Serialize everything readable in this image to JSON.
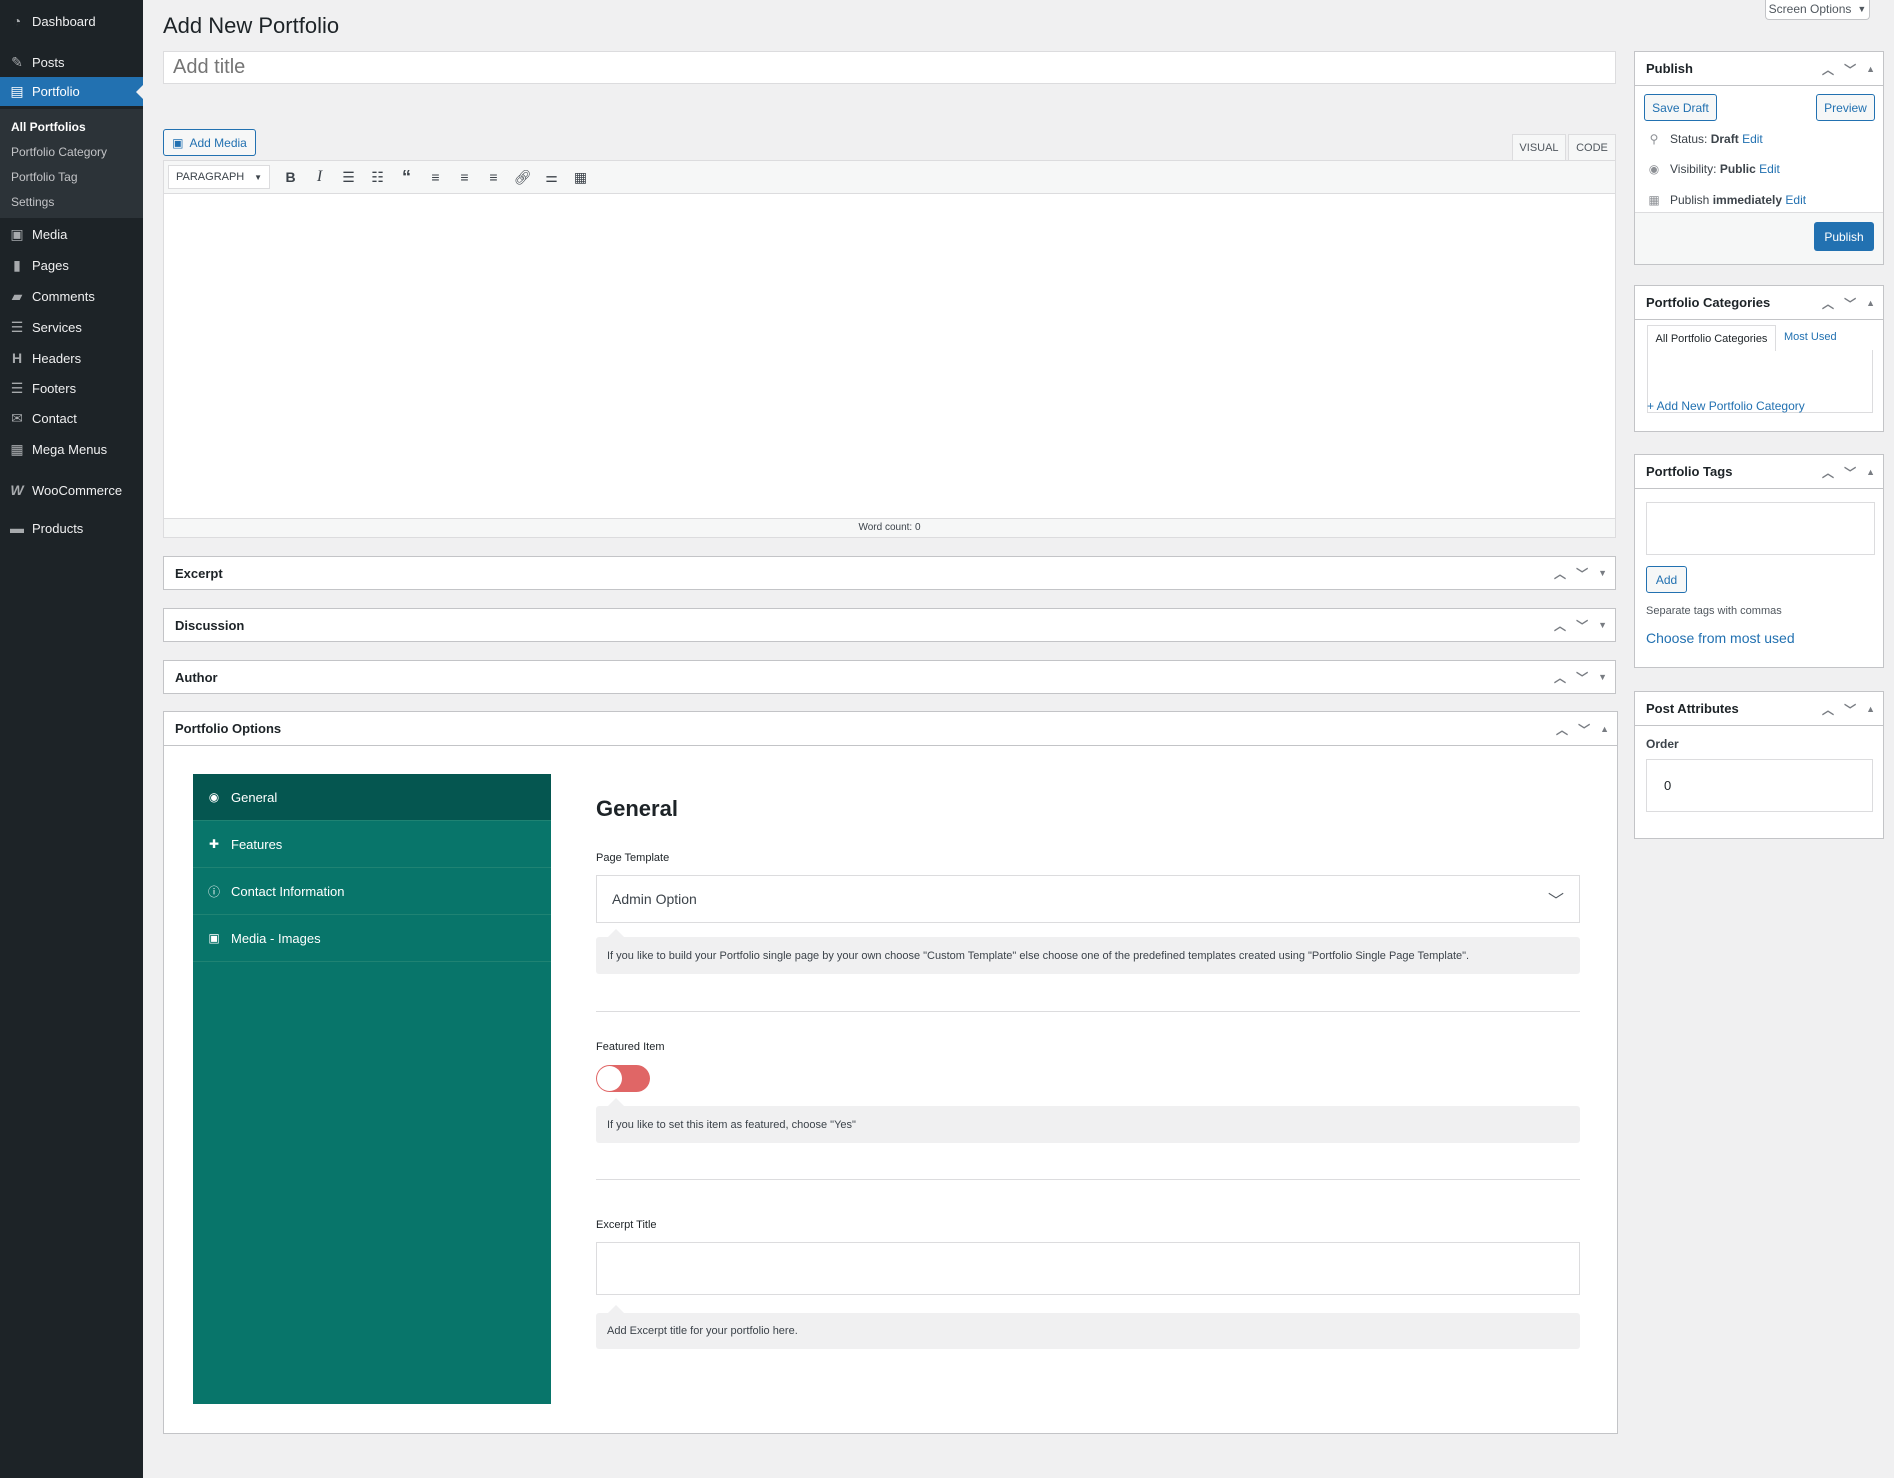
{
  "sidebar": {
    "items": [
      {
        "label": "Dashboard",
        "icon": "dashboard-icon"
      },
      {
        "label": "Posts",
        "icon": "pin-icon"
      },
      {
        "label": "Portfolio",
        "icon": "portfolio-icon"
      },
      {
        "label": "Media",
        "icon": "media-icon"
      },
      {
        "label": "Pages",
        "icon": "pages-icon"
      },
      {
        "label": "Comments",
        "icon": "comment-icon"
      },
      {
        "label": "Services",
        "icon": "services-icon"
      },
      {
        "label": "Headers",
        "icon": "header-icon"
      },
      {
        "label": "Footers",
        "icon": "footer-icon"
      },
      {
        "label": "Contact",
        "icon": "mail-icon"
      },
      {
        "label": "Mega Menus",
        "icon": "table-icon"
      },
      {
        "label": "WooCommerce",
        "icon": "woocommerce-icon"
      },
      {
        "label": "Products",
        "icon": "archive-icon"
      }
    ],
    "submenu": [
      "All Portfolios",
      "Portfolio Category",
      "Portfolio Tag",
      "Settings"
    ]
  },
  "header": {
    "title": "Add New Portfolio",
    "screen_options": "Screen Options"
  },
  "editor": {
    "title_placeholder": "Add title",
    "add_media": "Add Media",
    "tab_visual": "VISUAL",
    "tab_code": "CODE",
    "format": "PARAGRAPH",
    "word_count": "Word count: 0"
  },
  "metaboxes": {
    "excerpt": "Excerpt",
    "discussion": "Discussion",
    "author": "Author",
    "portfolio_options": "Portfolio Options"
  },
  "options": {
    "nav": [
      "General",
      "Features",
      "Contact Information",
      "Media - Images"
    ],
    "heading": "General",
    "page_template_label": "Page Template",
    "page_template_value": "Admin Option",
    "page_template_help": "If you like to build your Portfolio single page by your own choose \"Custom Template\" else choose one of the predefined templates created using \"Portfolio Single Page Template\".",
    "featured_label": "Featured Item",
    "featured_on": false,
    "featured_help": "If you like to set this item as featured, choose \"Yes\"",
    "excerpt_title_label": "Excerpt Title",
    "excerpt_title_value": "",
    "excerpt_title_help": "Add Excerpt title for your portfolio here."
  },
  "publish": {
    "title": "Publish",
    "save_draft": "Save Draft",
    "preview": "Preview",
    "status_label": "Status:",
    "status": "Draft",
    "visibility_label": "Visibility:",
    "visibility": "Public",
    "publish_label": "Publish",
    "publish_when": "immediately",
    "edit": "Edit",
    "publish_button": "Publish"
  },
  "categories": {
    "title": "Portfolio Categories",
    "tab_all": "All Portfolio Categories",
    "tab_most": "Most Used",
    "add_new": "+ Add New Portfolio Category"
  },
  "tags": {
    "title": "Portfolio Tags",
    "add": "Add",
    "hint": "Separate tags with commas",
    "choose": "Choose from most used"
  },
  "attributes": {
    "title": "Post Attributes",
    "order_label": "Order",
    "order_value": "0"
  },
  "colors": {
    "accent": "#2271b1",
    "sidebar": "#1d2327",
    "teal": "#08756a",
    "teal_dark": "#055650",
    "toggle_off": "#e06666"
  }
}
